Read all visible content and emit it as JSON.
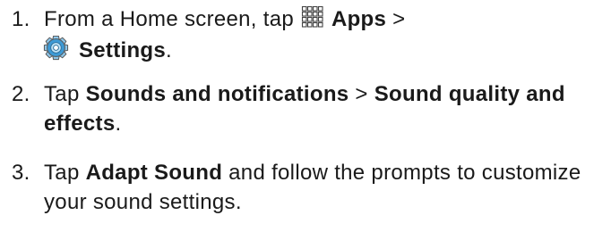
{
  "steps": [
    {
      "number": "1.",
      "text_before": "From a Home screen, tap",
      "apps_label": "Apps",
      "separator": ">",
      "settings_label": "Settings",
      "end": ".",
      "icons": [
        "apps-grid-icon",
        "settings-gear-icon"
      ]
    },
    {
      "number": "2.",
      "text_before": "Tap",
      "sounds_label": "Sounds and notifications",
      "separator": ">",
      "quality_label": "Sound quality and effects",
      "end": "."
    },
    {
      "number": "3.",
      "text_before": "Tap",
      "adapt_label": "Adapt Sound",
      "text_after": "and follow the prompts to customize your sound settings."
    }
  ],
  "colors": {
    "text": "#1a1a1a",
    "settings_icon_fill": "#3d9ad6",
    "settings_icon_stroke": "#555555"
  }
}
